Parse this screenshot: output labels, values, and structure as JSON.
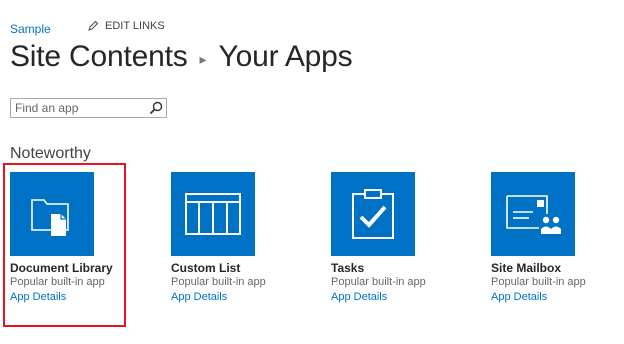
{
  "breadcrumb": {
    "site_label": "Sample",
    "edit_links_label": "EDIT LINKS"
  },
  "title": {
    "parent": "Site Contents",
    "current": "Your Apps"
  },
  "search": {
    "placeholder": "Find an app",
    "value": ""
  },
  "section": {
    "heading": "Noteworthy"
  },
  "apps": [
    {
      "name": "Document Library",
      "description": "Popular built-in app",
      "link": "App Details",
      "icon": "document-library-icon"
    },
    {
      "name": "Custom List",
      "description": "Popular built-in app",
      "link": "App Details",
      "icon": "custom-list-icon"
    },
    {
      "name": "Tasks",
      "description": "Popular built-in app",
      "link": "App Details",
      "icon": "tasks-icon"
    },
    {
      "name": "Site Mailbox",
      "description": "Popular built-in app",
      "link": "App Details",
      "icon": "site-mailbox-icon"
    }
  ],
  "colors": {
    "tile": "#0072c6",
    "link": "#0072c6",
    "highlight": "#e81123"
  }
}
